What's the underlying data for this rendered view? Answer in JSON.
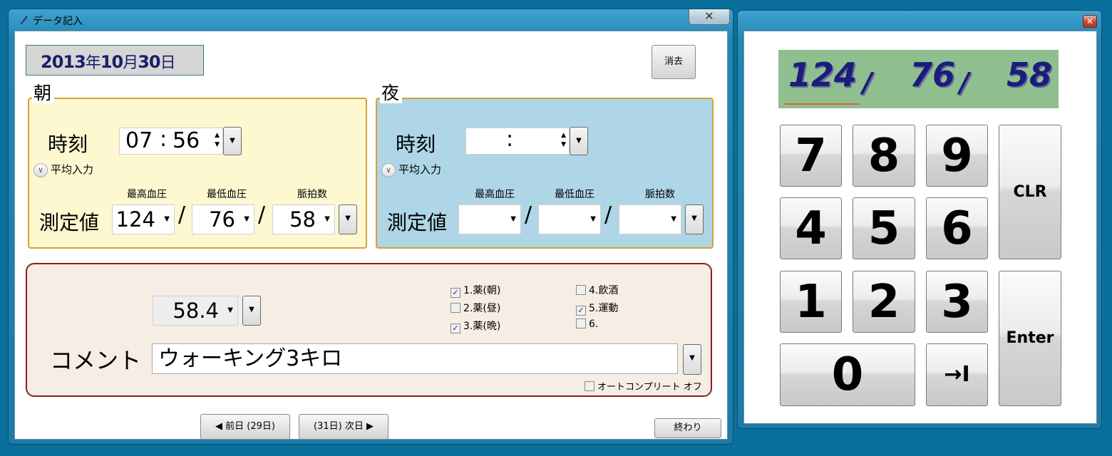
{
  "data_window": {
    "title": "データ記入",
    "close_label": "✕",
    "date": {
      "year": "2013",
      "y": "年",
      "month": "10",
      "m": "月",
      "day": "30",
      "d": "日"
    },
    "clear_label": "消去",
    "morning": {
      "title": "朝",
      "time_label": "時刻",
      "hour": "07",
      "minute": "56",
      "avg_label": "平均入力",
      "col_high": "最高血圧",
      "col_low": "最低血圧",
      "col_pulse": "脈拍数",
      "value_label": "測定値",
      "high": "124",
      "low": "76",
      "pulse": "58"
    },
    "night": {
      "title": "夜",
      "time_label": "時刻",
      "hour": "",
      "minute": "",
      "avg_label": "平均入力",
      "col_high": "最高血圧",
      "col_low": "最低血圧",
      "col_pulse": "脈拍数",
      "value_label": "測定値",
      "high": "",
      "low": "",
      "pulse": ""
    },
    "weight": "58.4",
    "checks": [
      {
        "label": "1.薬(朝)",
        "checked": true
      },
      {
        "label": "2.薬(昼)",
        "checked": false
      },
      {
        "label": "3.薬(晩)",
        "checked": true
      },
      {
        "label": "4.飲酒",
        "checked": false
      },
      {
        "label": "5.運動",
        "checked": true
      },
      {
        "label": "6.",
        "checked": false
      }
    ],
    "comment_label": "コメント",
    "comment_value": "ウォーキング3キロ",
    "autocomplete_label": "オートコンプリート オフ",
    "prev_label": "◀ 前日 (29日)",
    "next_label": "(31日) 次日 ▶",
    "end_label": "終わり",
    "slash": "/"
  },
  "keypad_window": {
    "close_label": "✕",
    "display": {
      "high": "124",
      "low": "76",
      "pulse": "58",
      "sep": "/"
    },
    "keys": {
      "k7": "7",
      "k8": "8",
      "k9": "9",
      "k4": "4",
      "k5": "5",
      "k6": "6",
      "k1": "1",
      "k2": "2",
      "k3": "3",
      "k0": "0",
      "tab": "→I",
      "clr": "CLR",
      "enter": "Enter"
    }
  }
}
